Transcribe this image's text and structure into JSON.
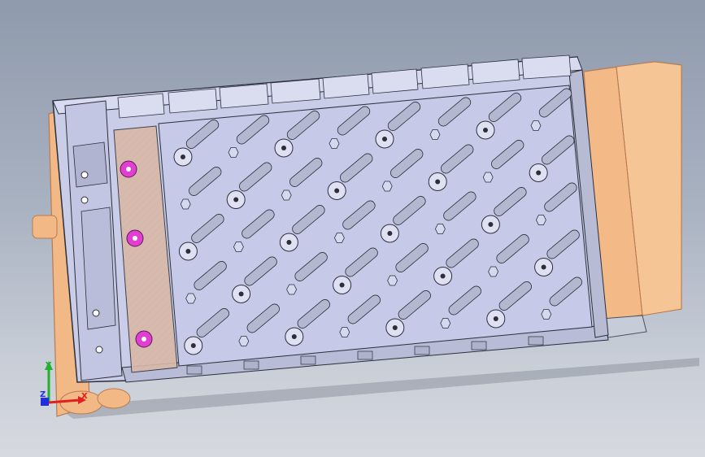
{
  "viewport": {
    "background_top": "#8f9aac",
    "background_bottom": "#d6d9df"
  },
  "model": {
    "tray_color": "#c9cde8",
    "edge_color": "#2b2f3a",
    "copper_color": "#f3ba88",
    "copper_edge": "#b87a4e",
    "busbar_color": "#d9b9a6",
    "terminal_color": "#e23fd2"
  },
  "triad": {
    "x_label": "X",
    "y_label": "Y",
    "z_label": "Z",
    "x_color": "#e02020",
    "y_color": "#22b030",
    "z_color": "#2030e0"
  }
}
